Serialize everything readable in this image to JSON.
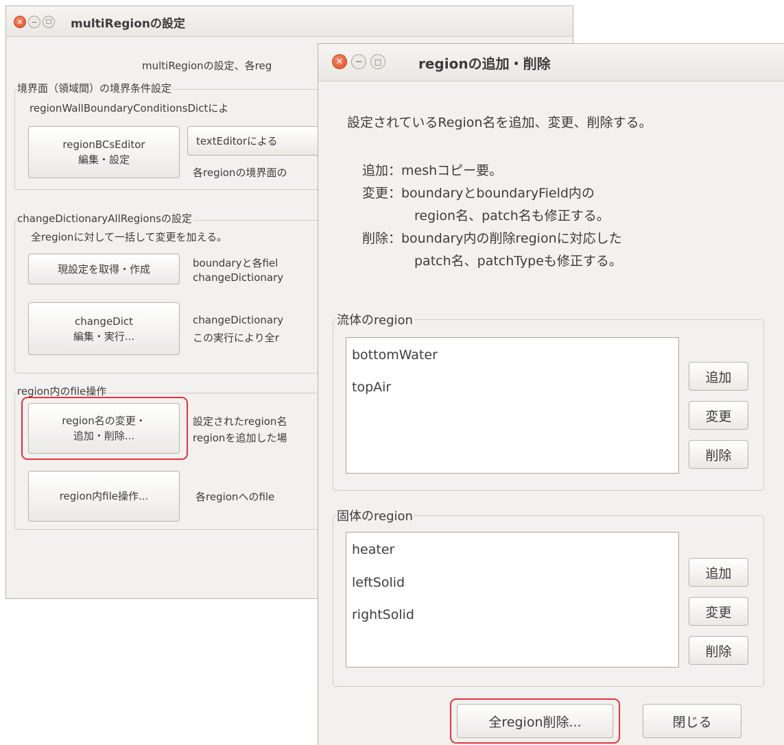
{
  "main_window": {
    "title": "multiRegionの設定",
    "header_text": "multiRegionの設定、各reg",
    "boundary_group": {
      "label": "境界面（領域間）の境界条件設定",
      "desc": "regionWallBoundaryConditionsDictによ",
      "bcs_editor_button": [
        "regionBCsEditor",
        "編集・設定"
      ],
      "text_editor_button": "textEditorによる",
      "note": "各regionの境界面の"
    },
    "change_dict_group": {
      "label": "changeDictionaryAllRegionsの設定",
      "desc": "全regionに対して一括して変更を加える。",
      "get_settings_button": "現設定を取得・作成",
      "get_settings_note": [
        "boundaryと各fiel",
        "changeDictionary"
      ],
      "change_dict_button": [
        "changeDict",
        "編集・実行..."
      ],
      "change_dict_note": [
        "changeDictionary",
        "この実行により全r"
      ]
    },
    "file_ops_group": {
      "label": "region内のfile操作",
      "rename_button": [
        "region名の変更・",
        "追加・削除..."
      ],
      "rename_note": [
        "設定されたregion名",
        "regionを追加した場"
      ],
      "file_op_button": "region内file操作...",
      "file_op_note": "各regionへのfile"
    }
  },
  "region_window": {
    "title": "regionの追加・削除",
    "intro": "設定されているRegion名を追加、変更、削除する。",
    "notes": [
      "追加：meshコピー要。",
      "変更：boundaryとboundaryField内の",
      "region名、patch名も修正する。",
      "削除：boundary内の削除regionに対応した",
      "patch名、patchTypeも修正する。"
    ],
    "fluid_group": {
      "label": "流体のregion",
      "items": [
        "bottomWater",
        "topAir"
      ],
      "add_button": "追加",
      "change_button": "変更",
      "delete_button": "削除"
    },
    "solid_group": {
      "label": "固体のregion",
      "items": [
        "heater",
        "leftSolid",
        "rightSolid"
      ],
      "add_button": "追加",
      "change_button": "変更",
      "delete_button": "削除"
    },
    "delete_all_button": "全region削除...",
    "close_button": "閉じる"
  },
  "colors": {
    "window_bg": "#f2f1f0",
    "close_button": "#df4b1f",
    "highlight": "#e5323c"
  },
  "icons": {
    "close": "close-icon",
    "minimize": "minimize-icon",
    "maximize": "maximize-icon"
  }
}
